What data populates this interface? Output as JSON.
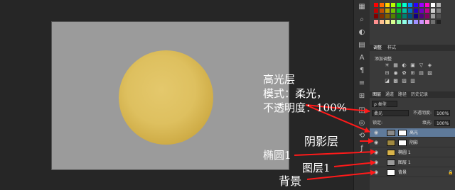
{
  "swatch_colors": [
    "#ff0000",
    "#ff6a00",
    "#ffd400",
    "#b8ff00",
    "#00ff3c",
    "#00ffd0",
    "#0092ff",
    "#2a00ff",
    "#9b00ff",
    "#ff00c8",
    "#ffffff",
    "#b0b0b0",
    "#c00000",
    "#c05000",
    "#c0a000",
    "#70c000",
    "#00c030",
    "#00c0a0",
    "#0070c0",
    "#2000c0",
    "#7000c0",
    "#c00090",
    "#d0d0d0",
    "#808080",
    "#800000",
    "#803000",
    "#806000",
    "#508000",
    "#008020",
    "#008070",
    "#004c80",
    "#100080",
    "#500080",
    "#800060",
    "#a0a0a0",
    "#505050",
    "#ff9090",
    "#ffc090",
    "#ffe890",
    "#d8ff90",
    "#90ffb0",
    "#90ffe8",
    "#90d0ff",
    "#a090ff",
    "#d090ff",
    "#ff90e0",
    "#707070",
    "#202020"
  ],
  "tool_icons": [
    "swatches-icon",
    "search-icon",
    "adjust-icon",
    "table-icon",
    "type-icon",
    "code-icon",
    "paragraph-icon",
    "align-icon",
    "layers-icon",
    "channels-icon",
    "history-icon",
    "fx-icon"
  ],
  "adjust_tabs": {
    "adjust": "调整",
    "styles": "样式"
  },
  "adjust_title": "添加调整",
  "adjust_icons": [
    "☀",
    "▦",
    "◐",
    "▣",
    "▽",
    "◈",
    "⊟",
    "◉",
    "✿",
    "⊞",
    "▤",
    "▧",
    "◪",
    "▩",
    "▨",
    "▥"
  ],
  "layers_tabs": {
    "layers": "图层",
    "channels": "通道",
    "paths": "路径",
    "history": "历史记录"
  },
  "kind_filter": "ρ 类型",
  "blend_mode": "柔光",
  "opacity_label": "不透明度:",
  "opacity_value": "100%",
  "lock_label": "锁定:",
  "fill_label": "填充:",
  "fill_value": "100%",
  "layers": [
    {
      "name": "高光",
      "thumb": "#8a8a8a",
      "selected": true
    },
    {
      "name": "阴影",
      "thumb": "#a08940",
      "selected": false
    },
    {
      "name": "椭圆 1",
      "thumb": "#d9b44a",
      "selected": false
    },
    {
      "name": "图层 1",
      "thumb": "#9b9b9b",
      "selected": false
    },
    {
      "name": "背景",
      "thumb": "#ffffff",
      "selected": false
    }
  ],
  "annotations": {
    "highlight_layer": "高光层",
    "mode_line": "模式：柔光，",
    "opacity_line": "不透明度：100%",
    "shadow_layer": "阴影层",
    "ellipse_layer": "椭圆1",
    "layer1": "图层1",
    "background": "背景"
  },
  "colors": {
    "arrow": "#ff1a1a",
    "selected_layer": "#5f7a9a"
  }
}
